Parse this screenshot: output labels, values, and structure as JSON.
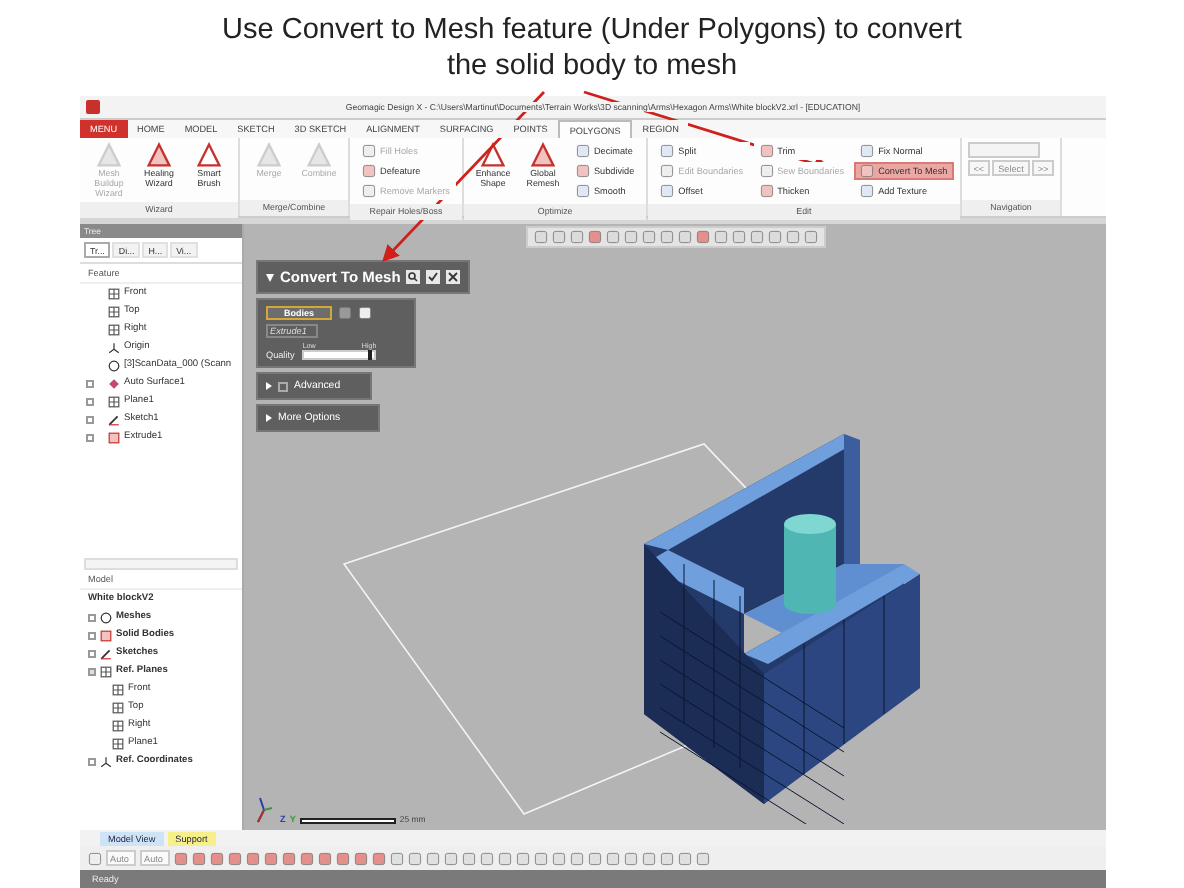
{
  "slide_title": [
    "Use Convert to Mesh feature (Under Polygons) to convert",
    "the solid body to mesh"
  ],
  "window": {
    "title": "Geomagic Design X - C:\\Users\\Martinut\\Documents\\Terrain Works\\3D scanning\\Arms\\Hexagon Arms\\White blockV2.xrl - [EDUCATION]"
  },
  "ribbon_tabs": [
    {
      "label": "MENU",
      "kind": "menu",
      "selected": false
    },
    {
      "label": "HOME",
      "kind": "tab",
      "selected": false
    },
    {
      "label": "MODEL",
      "kind": "tab",
      "selected": false
    },
    {
      "label": "SKETCH",
      "kind": "tab",
      "selected": false
    },
    {
      "label": "3D SKETCH",
      "kind": "tab",
      "selected": false
    },
    {
      "label": "ALIGNMENT",
      "kind": "tab",
      "selected": false
    },
    {
      "label": "SURFACING",
      "kind": "tab",
      "selected": false
    },
    {
      "label": "POINTS",
      "kind": "tab",
      "selected": false
    },
    {
      "label": "POLYGONS",
      "kind": "tab",
      "selected": true
    },
    {
      "label": "REGION",
      "kind": "tab",
      "selected": false
    }
  ],
  "ribbon_groups": [
    {
      "label": "Wizard",
      "tools": [
        {
          "label": "Mesh Buildup Wizard",
          "kind": "large",
          "disabled": true
        },
        {
          "label": "Healing Wizard",
          "kind": "large",
          "disabled": false
        },
        {
          "label": "Smart Brush",
          "kind": "large",
          "disabled": false
        }
      ]
    },
    {
      "label": "Merge/Combine",
      "tools": [
        {
          "label": "Merge",
          "kind": "large",
          "disabled": true
        },
        {
          "label": "Combine",
          "kind": "large",
          "disabled": true
        }
      ]
    },
    {
      "label": "Repair Holes/Boss",
      "tools": [
        {
          "label": "Fill Holes",
          "kind": "small",
          "disabled": true,
          "highlighted": false
        },
        {
          "label": "Defeature",
          "kind": "small",
          "disabled": false,
          "highlighted": false
        },
        {
          "label": "Remove Markers",
          "kind": "small",
          "disabled": true,
          "highlighted": false
        }
      ]
    },
    {
      "label": "Optimize",
      "tools": [
        {
          "label": "Enhance Shape",
          "kind": "large",
          "disabled": false
        },
        {
          "label": "Global Remesh",
          "kind": "large",
          "disabled": false
        },
        {
          "label": "Decimate",
          "kind": "small",
          "disabled": false,
          "highlighted": false
        },
        {
          "label": "Subdivide",
          "kind": "small",
          "disabled": false,
          "highlighted": false
        },
        {
          "label": "Smooth",
          "kind": "small",
          "disabled": false,
          "highlighted": false
        }
      ]
    },
    {
      "label": "Edit",
      "tools": [
        {
          "label": "Split",
          "kind": "small",
          "disabled": false,
          "highlighted": false
        },
        {
          "label": "Edit Boundaries",
          "kind": "small",
          "disabled": true,
          "highlighted": false
        },
        {
          "label": "Offset",
          "kind": "small",
          "disabled": false,
          "highlighted": false
        },
        {
          "label": "Trim",
          "kind": "small",
          "disabled": false,
          "highlighted": false
        },
        {
          "label": "Sew Boundaries",
          "kind": "small",
          "disabled": true,
          "highlighted": false
        },
        {
          "label": "Thicken",
          "kind": "small",
          "disabled": false,
          "highlighted": false
        },
        {
          "label": "Fix Normal",
          "kind": "small",
          "disabled": false,
          "highlighted": false
        },
        {
          "label": "Convert To Mesh",
          "kind": "small",
          "disabled": false,
          "highlighted": true
        },
        {
          "label": "Add Texture",
          "kind": "small",
          "disabled": false,
          "highlighted": false
        }
      ]
    },
    {
      "label": "Navigation",
      "tools": [
        {
          "label": "<<",
          "kind": "nav",
          "disabled": true
        },
        {
          "label": "Select",
          "kind": "nav",
          "disabled": true
        },
        {
          "label": ">>",
          "kind": "nav",
          "disabled": true
        }
      ]
    }
  ],
  "tree_panel": {
    "title": "Tree",
    "tabs": [
      {
        "label": "Tr...",
        "selected": true
      },
      {
        "label": "Di...",
        "selected": false
      },
      {
        "label": "H...",
        "selected": false
      },
      {
        "label": "Vi...",
        "selected": false
      }
    ],
    "section": "Feature",
    "items": [
      {
        "label": "Front",
        "expandable": false
      },
      {
        "label": "Top",
        "expandable": false
      },
      {
        "label": "Right",
        "expandable": false
      },
      {
        "label": "Origin",
        "expandable": false
      },
      {
        "label": "[3]ScanData_000 (Scann",
        "expandable": false
      },
      {
        "label": "Auto Surface1",
        "expandable": true
      },
      {
        "label": "Plane1",
        "expandable": true
      },
      {
        "label": "Sketch1",
        "expandable": true
      },
      {
        "label": "Extrude1",
        "expandable": true
      }
    ]
  },
  "model_panel": {
    "section": "Model",
    "root": "White blockV2",
    "items": [
      {
        "label": "Meshes",
        "expanded": false
      },
      {
        "label": "Solid Bodies",
        "expanded": false
      },
      {
        "label": "Sketches",
        "expanded": false
      },
      {
        "label": "Ref. Planes",
        "expanded": true,
        "children": [
          {
            "label": "Front"
          },
          {
            "label": "Top"
          },
          {
            "label": "Right"
          },
          {
            "label": "Plane1"
          }
        ]
      },
      {
        "label": "Ref. Coordinates",
        "expanded": false
      }
    ]
  },
  "convert_panel": {
    "title": "Convert To Mesh",
    "selector": "Bodies",
    "entity": "Extrude1",
    "quality": {
      "label": "Quality",
      "low": "Low",
      "high": "High",
      "level": 0.95
    },
    "sections": [
      {
        "label": "Advanced",
        "kind": "checkbox",
        "checked": false
      },
      {
        "label": "More Options",
        "kind": "plain"
      }
    ]
  },
  "viewport": {
    "axes": [
      "Z",
      "Y"
    ],
    "scale": "25 mm"
  },
  "view_tabs": [
    {
      "label": "Model View",
      "color": "#cfe3f7"
    },
    {
      "label": "Support",
      "color": "#f7f08a"
    }
  ],
  "bottom_toolbar": {
    "dropdowns": [
      "Auto",
      "Auto"
    ]
  },
  "status_bar": "Ready"
}
